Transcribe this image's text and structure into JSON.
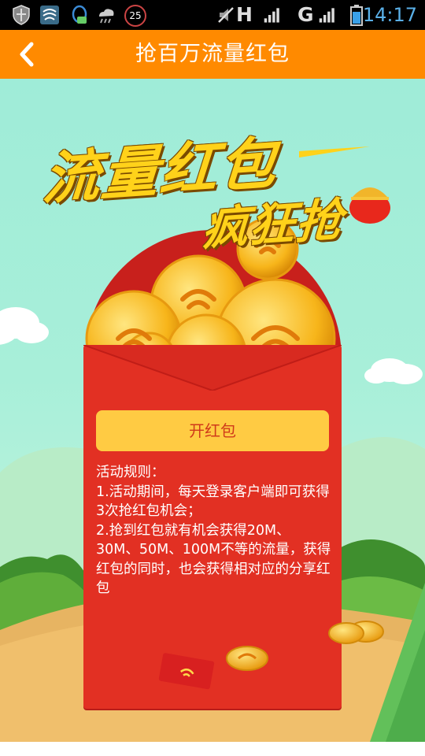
{
  "status_bar": {
    "notification_badge": "25",
    "network_1": "H",
    "network_2": "G",
    "time": "14:17"
  },
  "header": {
    "title": "抢百万流量红包"
  },
  "banner": {
    "headline_line1": "流量红包",
    "headline_line2": "疯狂抢"
  },
  "envelope": {
    "open_button_label": "开红包",
    "rules": [
      "活动规则：",
      "1.活动期间，每天登录客户端即可获得3次抢红包机会；",
      "2.抢到红包就有机会获得20M、30M、50M、100M不等的流量，获得红包的同时，也会获得相对应的分享红包"
    ]
  },
  "colors": {
    "header_bg": "#ff8a00",
    "envelope_red": "#e23023",
    "button_yellow": "#ffcb43",
    "sky": "#9fecd8"
  }
}
